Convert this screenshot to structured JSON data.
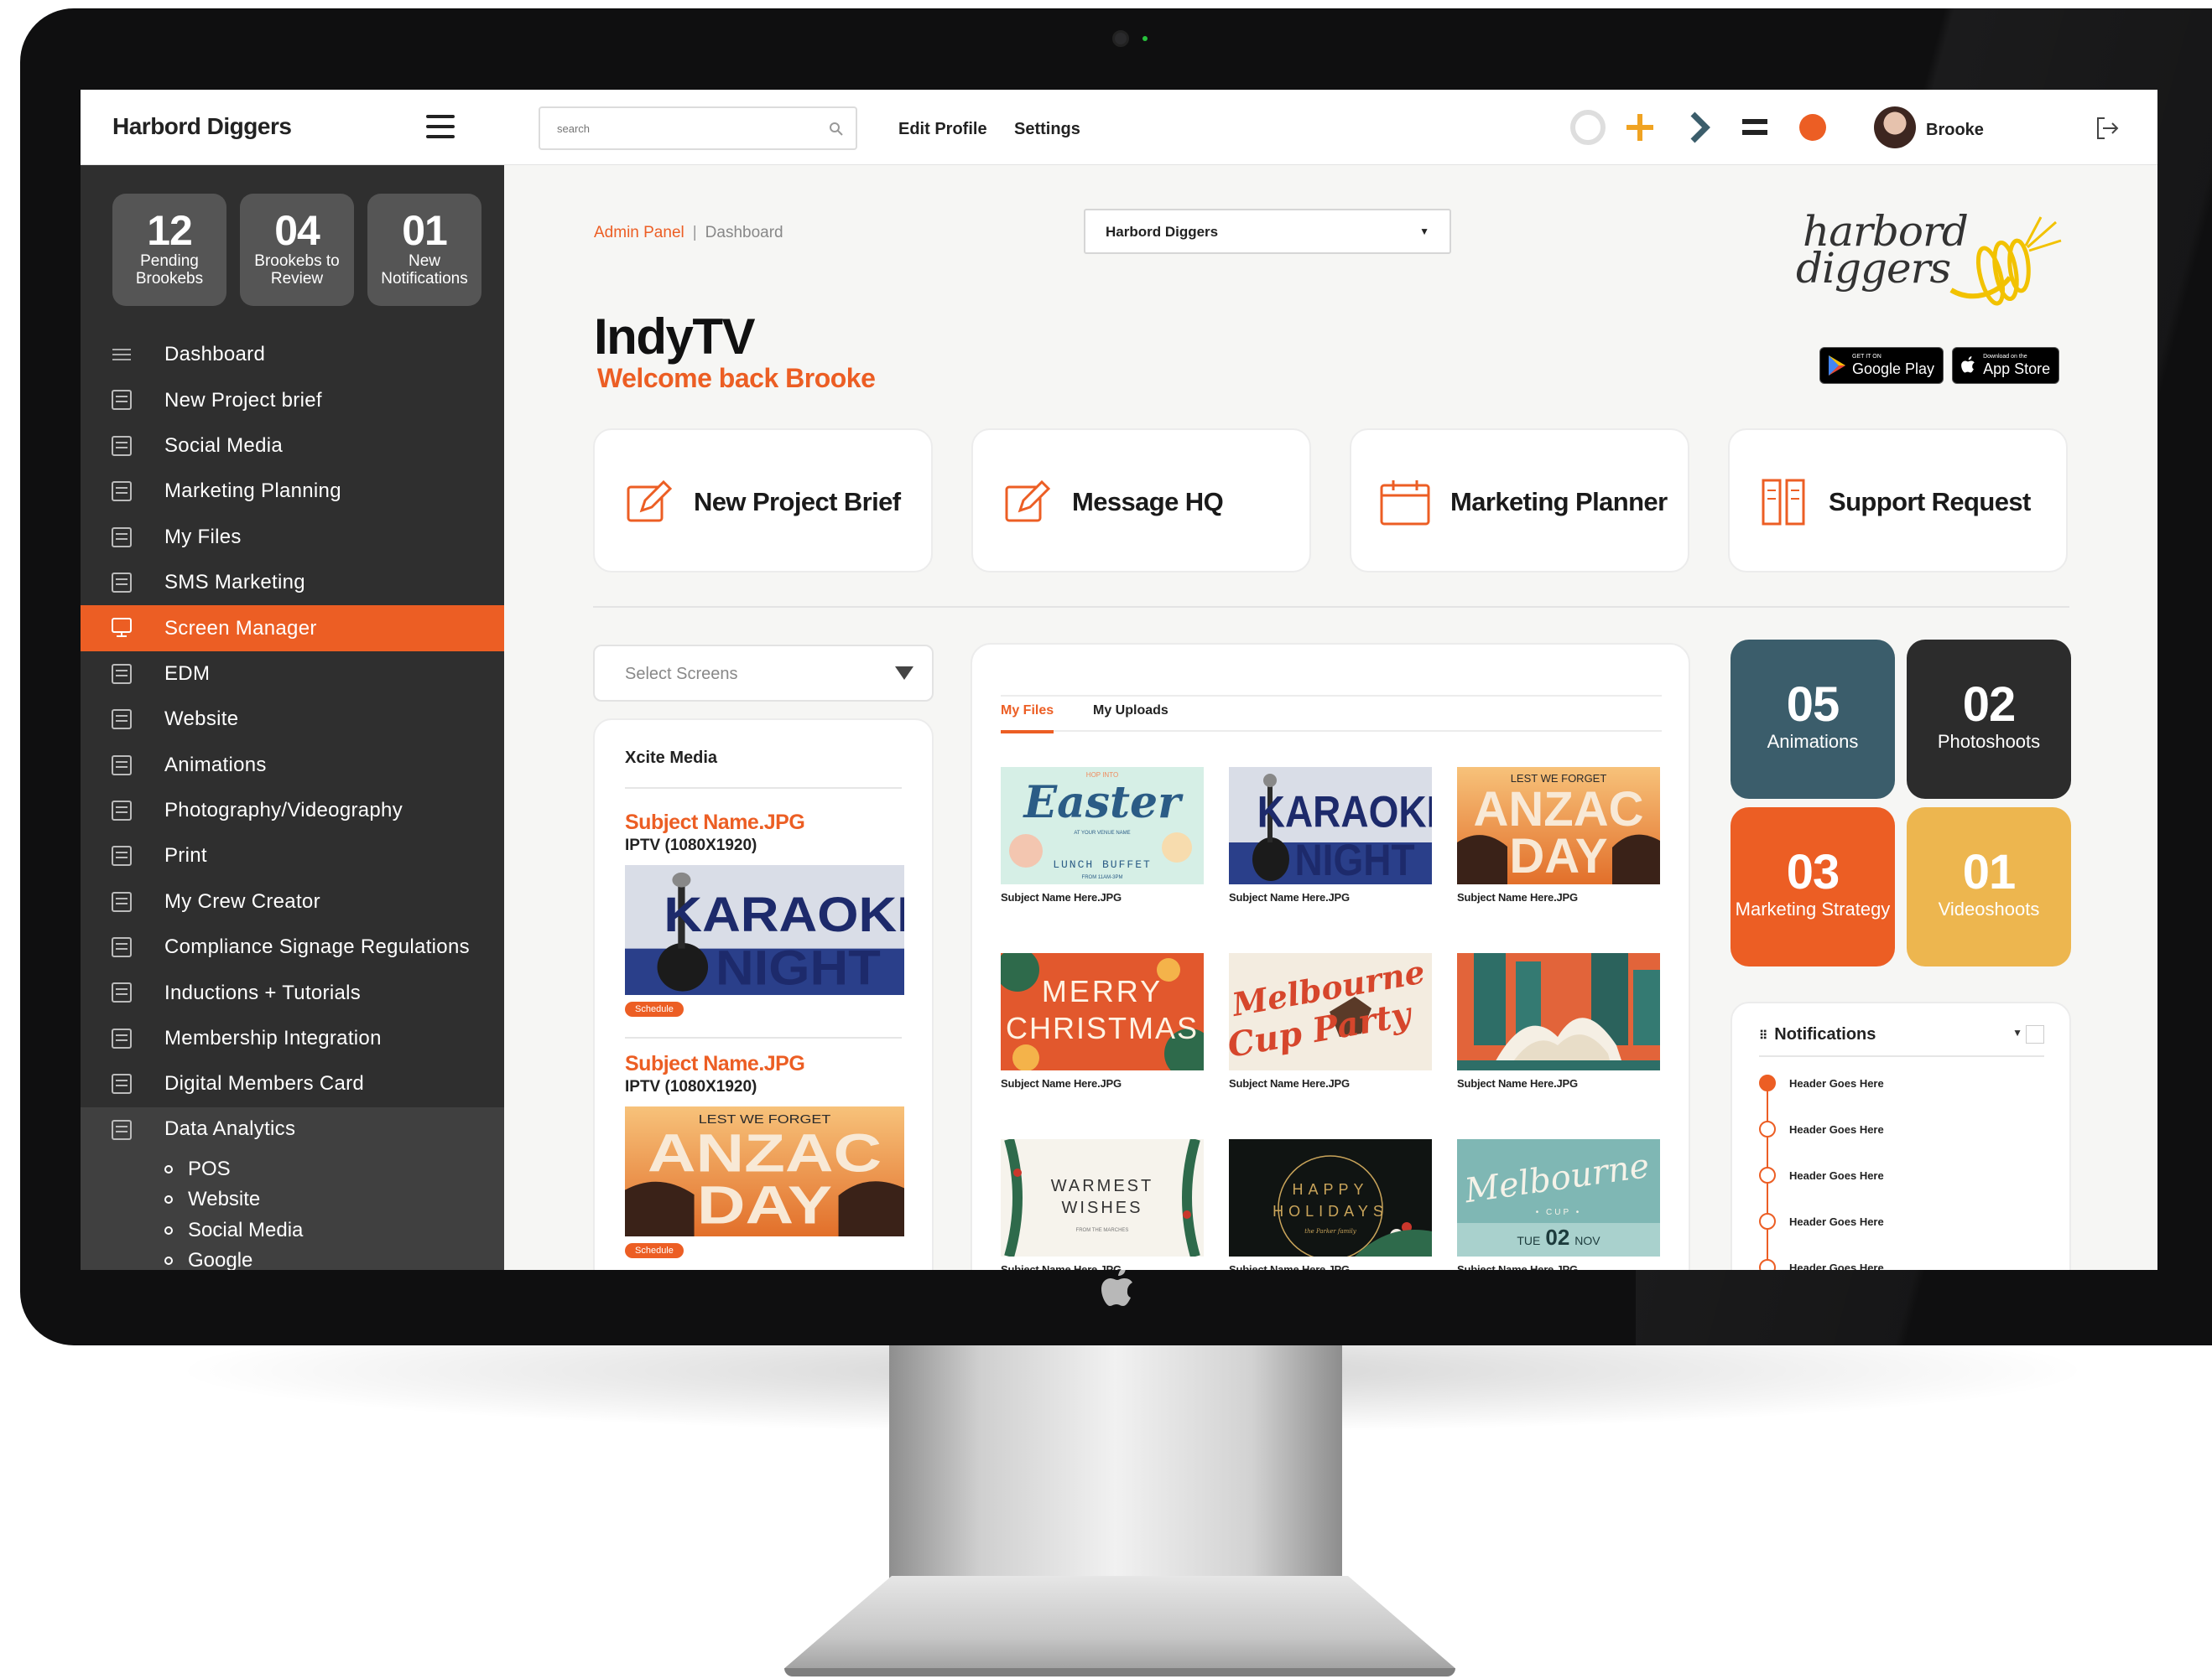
{
  "topbar": {
    "brand": "Harbord Diggers",
    "search_placeholder": "search",
    "edit_profile": "Edit Profile",
    "settings": "Settings",
    "user_name": "Brooke"
  },
  "sidebar": {
    "stats": [
      {
        "num": "12",
        "label": "Pending Brookebs"
      },
      {
        "num": "04",
        "label": "Brookebs to Review"
      },
      {
        "num": "01",
        "label": "New Notifications"
      }
    ],
    "items": [
      {
        "label": "Dashboard",
        "icon": "menu-icon"
      },
      {
        "label": "New Project brief",
        "icon": "document-icon"
      },
      {
        "label": "Social Media",
        "icon": "thumbs-up-icon"
      },
      {
        "label": "Marketing Planning",
        "icon": "calendar-icon"
      },
      {
        "label": "My Files",
        "icon": "files-icon"
      },
      {
        "label": "SMS Marketing",
        "icon": "bar-chart-icon"
      },
      {
        "label": "Screen Manager",
        "icon": "screen-icon",
        "active": true
      },
      {
        "label": "EDM",
        "icon": "newsletter-icon"
      },
      {
        "label": "Website",
        "icon": "monitor-icon"
      },
      {
        "label": "Animations",
        "icon": "image-icon"
      },
      {
        "label": "Photography/Videography",
        "icon": "gallery-icon"
      },
      {
        "label": "Print",
        "icon": "picture-icon"
      },
      {
        "label": "My Crew Creator",
        "icon": "clapper-icon"
      },
      {
        "label": "Compliance Signage Regulations",
        "icon": "checkbox-icon"
      },
      {
        "label": "Inductions + Tutorials",
        "icon": "tutorial-icon"
      },
      {
        "label": "Membership Integration",
        "icon": "grid-icon"
      },
      {
        "label": "Digital Members Card",
        "icon": "card-icon"
      }
    ],
    "analytics": {
      "label": "Data Analytics",
      "icon": "analytics-icon",
      "children": [
        "POS",
        "Website",
        "Social Media",
        "Google"
      ]
    }
  },
  "main": {
    "breadcrumb": {
      "admin": "Admin Panel",
      "separator": "|",
      "current": "Dashboard"
    },
    "site_select": "Harbord Diggers",
    "title": "IndyTV",
    "welcome": "Welcome back Brooke",
    "logo": {
      "line1": "harbord",
      "line2": "diggers"
    },
    "badges": {
      "google": {
        "small": "GET IT ON",
        "big": "Google Play"
      },
      "apple": {
        "small": "Download on the",
        "big": "App Store"
      }
    },
    "actions": [
      {
        "label": "New Project Brief",
        "icon": "edit-icon"
      },
      {
        "label": "Message HQ",
        "icon": "edit-icon"
      },
      {
        "label": "Marketing Planner",
        "icon": "calendar-icon"
      },
      {
        "label": "Support Request",
        "icon": "columns-icon"
      }
    ],
    "screens": {
      "select_placeholder": "Select Screens",
      "provider": "Xcite Media",
      "entries": [
        {
          "name": "Subject Name.JPG",
          "spec": "IPTV (1080X1920)",
          "badge": "Schedule",
          "thumb": "karaoke"
        },
        {
          "name": "Subject Name.JPG",
          "spec": "IPTV (1080X1920)",
          "badge": "Schedule",
          "thumb": "anzac"
        }
      ]
    },
    "files": {
      "tabs": [
        "My Files",
        "My Uploads"
      ],
      "items": [
        {
          "caption": "Subject Name Here.JPG",
          "art": "easter"
        },
        {
          "caption": "Subject Name Here.JPG",
          "art": "karaoke"
        },
        {
          "caption": "Subject Name Here.JPG",
          "art": "anzac"
        },
        {
          "caption": "Subject Name Here.JPG",
          "art": "christmas"
        },
        {
          "caption": "Subject Name Here.JPG",
          "art": "melbcup"
        },
        {
          "caption": "Subject Name Here.JPG",
          "art": "opera"
        },
        {
          "caption": "Subject Name Here.JPG",
          "art": "warmest"
        },
        {
          "caption": "Subject Name Here.JPG",
          "art": "holidays"
        },
        {
          "caption": "Subject Name Here.JPG",
          "art": "melbourne"
        }
      ],
      "art_text": {
        "easter": {
          "top": "HOP INTO",
          "main": "Easter",
          "sub": "AT YOUR VENUE NAME",
          "foot": "LUNCH BUFFET",
          "foot2": "FROM 11AM-3PM"
        },
        "karaoke": {
          "line1": "KARAOKE",
          "line2": "NIGHT"
        },
        "anzac": {
          "small": "LEST WE FORGET",
          "line1": "ANZAC",
          "line2": "DAY"
        },
        "christmas": {
          "line1": "MERRY",
          "line2": "CHRISTMAS"
        },
        "melbcup": {
          "line1": "Melbourne",
          "line2": "Cup Party"
        },
        "warmest": {
          "line1": "WARMEST",
          "line2": "WISHES",
          "small": "FROM THE MARCHES"
        },
        "holidays": {
          "line1": "HAPPY",
          "line2": "HOLIDAYS",
          "small": "the Parker family"
        },
        "melbourne": {
          "line1": "Melbourne",
          "line2": "• CUP •",
          "line3": "TUE",
          "line4": "02",
          "line5": "NOV"
        }
      }
    },
    "tiles": [
      {
        "num": "05",
        "label": "Animations",
        "color": "#3b5d6b"
      },
      {
        "num": "02",
        "label": "Photoshoots",
        "color": "#2c2c2c"
      },
      {
        "num": "03",
        "label": "Marketing Strategy",
        "color": "#ec5e24"
      },
      {
        "num": "01",
        "label": "Videoshoots",
        "color": "#edb64f"
      }
    ],
    "notifications": {
      "title": "Notifications",
      "items": [
        "Header Goes Here",
        "Header Goes Here",
        "Header Goes Here",
        "Header Goes Here",
        "Header Goes Here"
      ]
    }
  },
  "colors": {
    "accent": "#ec5e24",
    "sidebar": "#2f2f2f",
    "teal": "#3b5d6b",
    "yellow": "#edb64f"
  }
}
